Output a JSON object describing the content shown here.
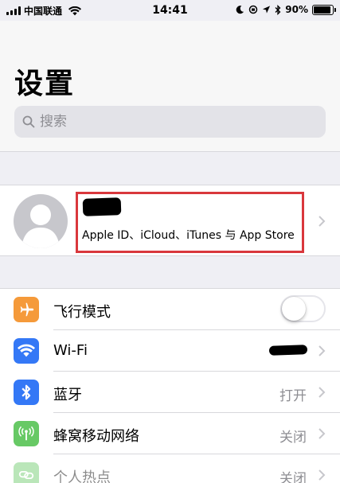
{
  "status_bar": {
    "carrier": "中国联通",
    "time": "14:41",
    "battery_percent": "90%",
    "battery_level": 0.9
  },
  "header": {
    "title": "设置",
    "search_placeholder": "搜索"
  },
  "profile": {
    "subtitle": "Apple ID、iCloud、iTunes 与 App Store"
  },
  "settings": [
    {
      "label": "飞行模式",
      "icon": "airplane-icon",
      "color": "#f59a3a",
      "toggle": false
    },
    {
      "label": "Wi-Fi",
      "icon": "wifi-icon",
      "color": "#3478f6"
    },
    {
      "label": "蓝牙",
      "icon": "bluetooth-icon",
      "color": "#3478f6",
      "value": "打开"
    },
    {
      "label": "蜂窝移动网络",
      "icon": "cellular-icon",
      "color": "#67c965",
      "value": "关闭"
    },
    {
      "label": "个人热点",
      "icon": "hotspot-icon",
      "color": "#67c965",
      "value": "关闭"
    }
  ],
  "colors": {
    "highlight_box": "#d9373c",
    "background": "#efeff4",
    "secondary_text": "#8e8e93"
  }
}
